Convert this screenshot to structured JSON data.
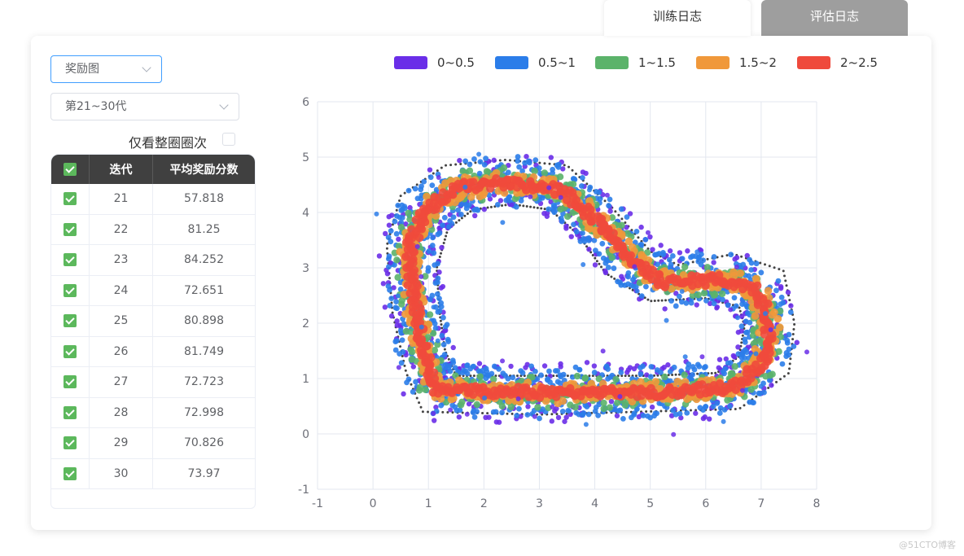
{
  "tabs": [
    {
      "label": "训练日志",
      "active": true
    },
    {
      "label": "评估日志",
      "active": false
    }
  ],
  "controls": {
    "chart_select": "奖励图",
    "range_select": "第21~30代",
    "full_lap_label": "仅看整圈圈次",
    "full_lap_checked": false
  },
  "table": {
    "headers": [
      "迭代",
      "平均奖励分数"
    ],
    "rows": [
      {
        "iter": "21",
        "reward": "57.818",
        "checked": true
      },
      {
        "iter": "22",
        "reward": "81.25",
        "checked": true
      },
      {
        "iter": "23",
        "reward": "84.252",
        "checked": true
      },
      {
        "iter": "24",
        "reward": "72.651",
        "checked": true
      },
      {
        "iter": "25",
        "reward": "80.898",
        "checked": true
      },
      {
        "iter": "26",
        "reward": "81.749",
        "checked": true
      },
      {
        "iter": "27",
        "reward": "72.723",
        "checked": true
      },
      {
        "iter": "28",
        "reward": "72.998",
        "checked": true
      },
      {
        "iter": "29",
        "reward": "70.826",
        "checked": true
      },
      {
        "iter": "30",
        "reward": "73.97",
        "checked": true
      }
    ]
  },
  "watermark": "@51CTO博客",
  "chart_data": {
    "type": "scatter",
    "xlim": [
      -1,
      8
    ],
    "ylim": [
      -1,
      6
    ],
    "x_ticks": [
      "-1",
      "0",
      "1",
      "2",
      "3",
      "4",
      "5",
      "6",
      "7",
      "8"
    ],
    "y_ticks": [
      "-1",
      "0",
      "1",
      "2",
      "3",
      "4",
      "5",
      "6"
    ],
    "grid": true,
    "legend_position": "top",
    "series": [
      {
        "name": "0~0.5",
        "color": "#6a2ee8"
      },
      {
        "name": "0.5~1",
        "color": "#2b7de9"
      },
      {
        "name": "1~1.5",
        "color": "#5bb36a"
      },
      {
        "name": "1.5~2",
        "color": "#f0983a"
      },
      {
        "name": "2~2.5",
        "color": "#ef4a3c"
      }
    ],
    "track_centerline": [
      [
        1.1,
        0.8
      ],
      [
        3.0,
        0.75
      ],
      [
        5.0,
        0.75
      ],
      [
        6.5,
        0.85
      ],
      [
        7.05,
        1.3
      ],
      [
        7.15,
        2.0
      ],
      [
        6.9,
        2.6
      ],
      [
        6.3,
        2.8
      ],
      [
        5.2,
        2.75
      ],
      [
        4.6,
        3.2
      ],
      [
        4.1,
        3.8
      ],
      [
        3.4,
        4.4
      ],
      [
        2.5,
        4.55
      ],
      [
        1.5,
        4.45
      ],
      [
        0.9,
        4.0
      ],
      [
        0.65,
        3.3
      ],
      [
        0.75,
        2.3
      ],
      [
        0.95,
        1.4
      ],
      [
        1.1,
        0.8
      ]
    ],
    "track_outer": [
      [
        0.9,
        0.4
      ],
      [
        3.0,
        0.35
      ],
      [
        6.6,
        0.45
      ],
      [
        7.5,
        1.1
      ],
      [
        7.6,
        2.0
      ],
      [
        7.4,
        2.95
      ],
      [
        6.5,
        3.25
      ],
      [
        5.5,
        3.05
      ],
      [
        5.0,
        3.3
      ],
      [
        4.3,
        4.1
      ],
      [
        3.5,
        4.85
      ],
      [
        2.4,
        4.95
      ],
      [
        1.3,
        4.85
      ],
      [
        0.5,
        4.3
      ],
      [
        0.25,
        3.4
      ],
      [
        0.35,
        2.2
      ],
      [
        0.6,
        1.1
      ],
      [
        0.9,
        0.4
      ]
    ],
    "track_inner": [
      [
        1.5,
        1.05
      ],
      [
        3.0,
        1.05
      ],
      [
        5.0,
        1.05
      ],
      [
        6.2,
        1.1
      ],
      [
        6.6,
        1.4
      ],
      [
        6.7,
        1.95
      ],
      [
        6.6,
        2.3
      ],
      [
        6.0,
        2.45
      ],
      [
        5.0,
        2.4
      ],
      [
        4.2,
        2.9
      ],
      [
        3.7,
        3.6
      ],
      [
        3.2,
        4.05
      ],
      [
        2.5,
        4.15
      ],
      [
        1.8,
        4.05
      ],
      [
        1.35,
        3.7
      ],
      [
        1.15,
        3.0
      ],
      [
        1.2,
        2.2
      ],
      [
        1.3,
        1.5
      ],
      [
        1.5,
        1.05
      ]
    ]
  }
}
